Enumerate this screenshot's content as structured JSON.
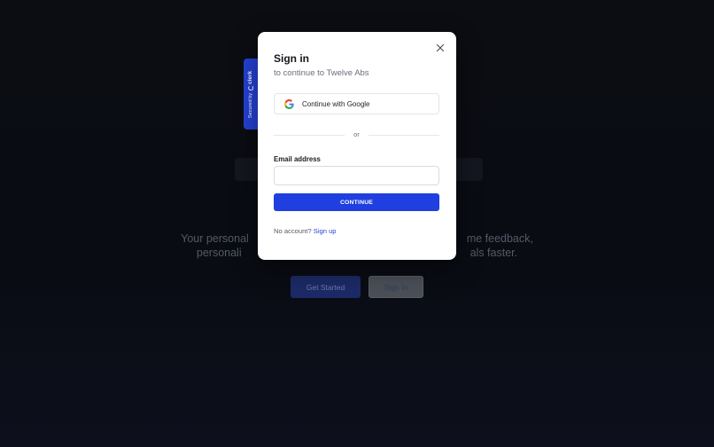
{
  "background": {
    "tagline_line1_left": "Your personal",
    "tagline_line1_right": "me feedback,",
    "tagline_line2_left": "personali",
    "tagline_line2_right": "als faster.",
    "get_started_label": "Get Started",
    "sign_in_label": "Sign In"
  },
  "badge": {
    "secured_by": "Secured by",
    "brand": "clerk",
    "logo_icon": "clerk-logo-icon"
  },
  "modal": {
    "title": "Sign in",
    "subtitle": "to continue to Twelve Abs",
    "google_button_label": "Continue with Google",
    "google_icon": "google-g-icon",
    "divider_text": "or",
    "email_label": "Email address",
    "email_value": "",
    "email_placeholder": "",
    "continue_label": "CONTINUE",
    "footer_text": "No account?",
    "signup_link": "Sign up",
    "close_icon": "close-icon"
  },
  "colors": {
    "accent": "#1f3fe0",
    "badge": "#2442d8",
    "background": "#0b0d12"
  }
}
